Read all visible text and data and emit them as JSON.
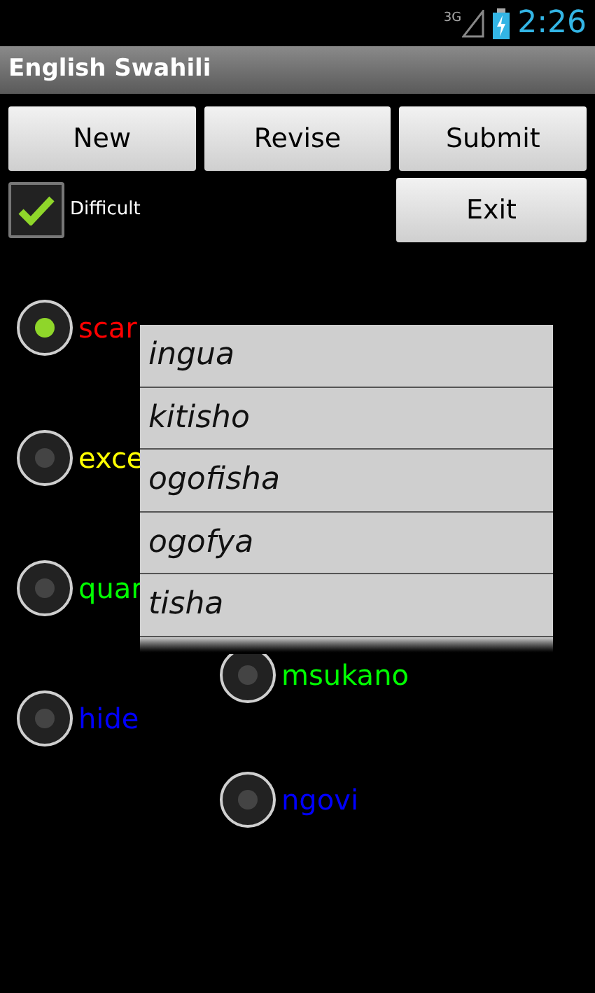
{
  "status_bar": {
    "network": "3G",
    "time": "2:26"
  },
  "window": {
    "title": "English Swahili"
  },
  "buttons": [
    "New",
    "Revise",
    "Submit"
  ],
  "difficult": {
    "label": "Difficult",
    "checked": true
  },
  "exit_button": "Exit",
  "options_left": [
    {
      "label": "scar",
      "color": "#ff0000",
      "selected": true
    },
    {
      "label": "exce",
      "color": "#ffff00",
      "selected": false
    },
    {
      "label": "quar",
      "color": "#00ff00",
      "selected": false
    },
    {
      "label": "hide",
      "color": "#0000ff",
      "selected": false
    }
  ],
  "options_right": [
    {
      "label": "msukano",
      "color": "#00ff00",
      "selected": false
    },
    {
      "label": "ngovi",
      "color": "#0000ff",
      "selected": false
    }
  ],
  "dropdown": {
    "items": [
      "ingua",
      "kitisho",
      "ogofisha",
      "ogofya",
      "tisha"
    ]
  }
}
